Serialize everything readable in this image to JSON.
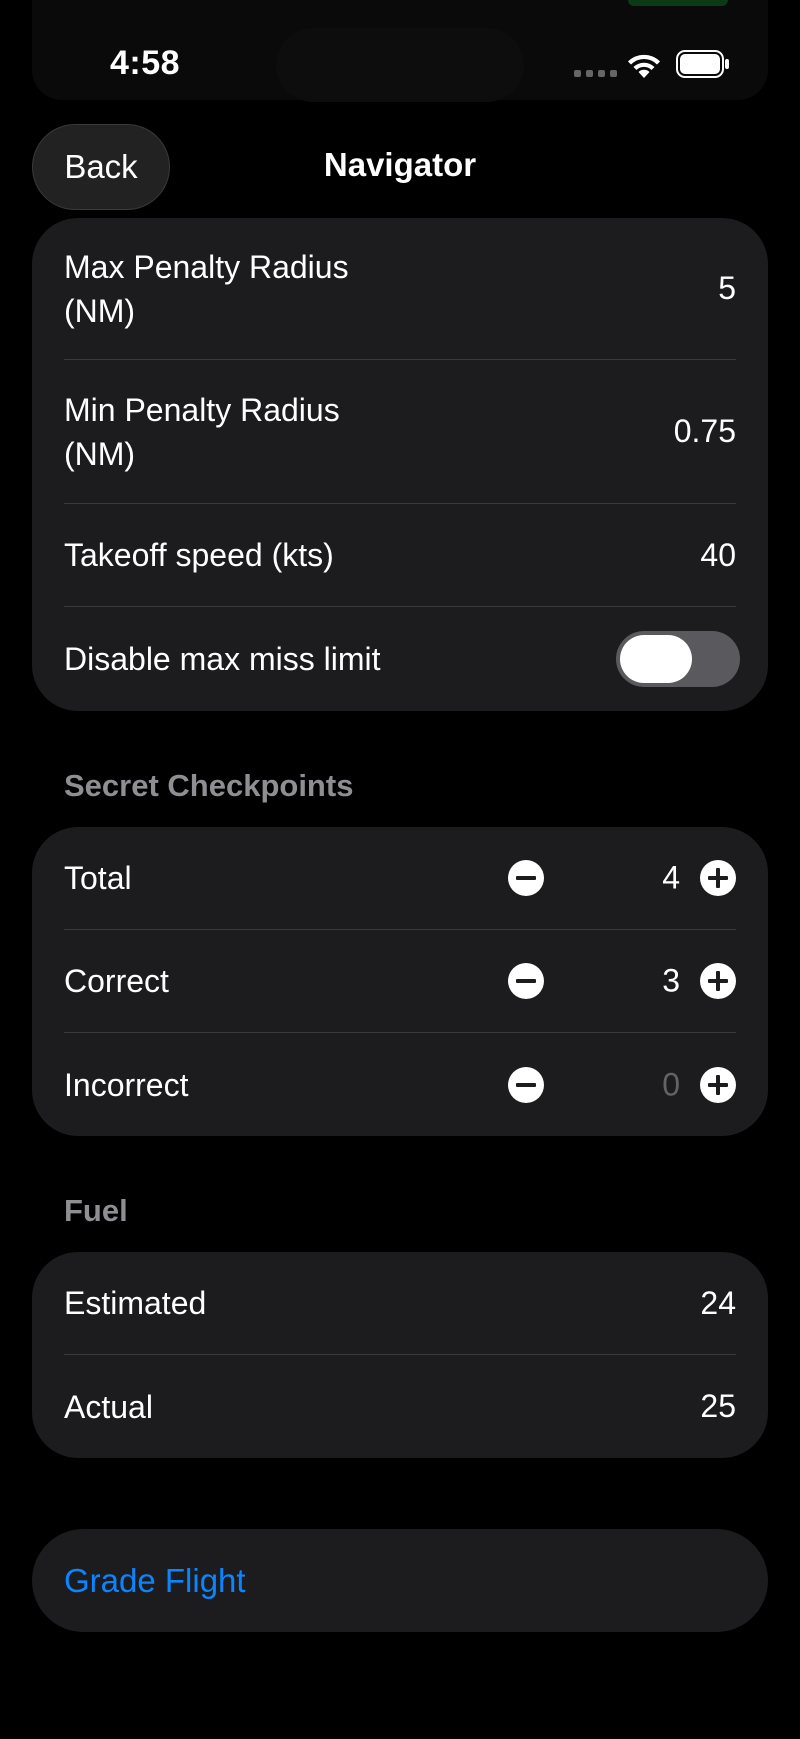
{
  "status_bar": {
    "time": "4:58"
  },
  "nav": {
    "back_label": "Back",
    "title": "Navigator"
  },
  "settings": {
    "rows": [
      {
        "label": "Max Penalty Radius\n(NM)",
        "value": "5"
      },
      {
        "label": "Min Penalty Radius\n(NM)",
        "value": "0.75"
      },
      {
        "label": "Takeoff speed (kts)",
        "value": "40"
      }
    ],
    "toggle": {
      "label": "Disable max miss limit",
      "on": false
    }
  },
  "secret_checkpoints": {
    "header": "Secret Checkpoints",
    "rows": [
      {
        "label": "Total",
        "value": "4"
      },
      {
        "label": "Correct",
        "value": "3"
      },
      {
        "label": "Incorrect",
        "value": "0"
      }
    ]
  },
  "fuel": {
    "header": "Fuel",
    "rows": [
      {
        "label": "Estimated",
        "value": "24"
      },
      {
        "label": "Actual",
        "value": "25"
      }
    ]
  },
  "action": {
    "label": "Grade Flight"
  },
  "colors": {
    "background": "#000000",
    "card": "#1c1c1e",
    "separator": "#3a3a3c",
    "section_header": "#8e8e93",
    "accent": "#0a84ff",
    "toggle_off": "#5a5a5e",
    "muted_value": "#636366"
  }
}
